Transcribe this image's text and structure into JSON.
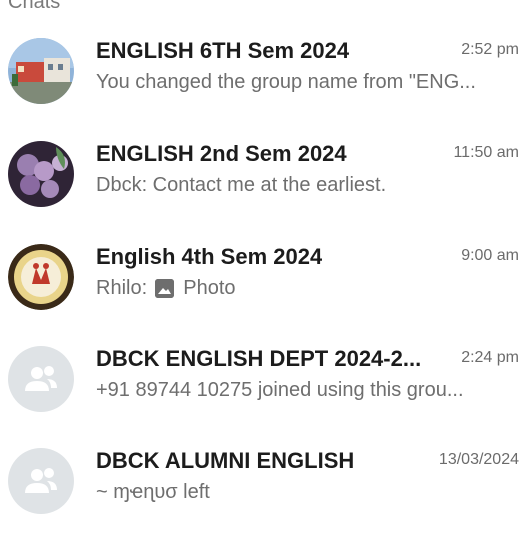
{
  "top_partial_label": "Chats",
  "chats": [
    {
      "name": "ENGLISH 6TH Sem 2024",
      "time": "2:52 pm",
      "preview": "You changed the group name from \"ENG...",
      "avatar": "building-photo"
    },
    {
      "name": "ENGLISH 2nd  Sem 2024",
      "time": "11:50 am",
      "preview": "Dbck: Contact me at the earliest.",
      "avatar": "berries-photo"
    },
    {
      "name": "English 4th Sem 2024",
      "time": "9:00 am",
      "preview_sender": "Rhilo:",
      "preview_icon": "photo-icon",
      "preview_text": "Photo",
      "avatar": "emblem-logo"
    },
    {
      "name": "DBCK ENGLISH DEPT 2024-2...",
      "time": "2:24 pm",
      "preview": "+91 89744 10275 joined using this grou...",
      "avatar": "default-group-icon"
    },
    {
      "name": "DBCK ALUMNI ENGLISH",
      "time": "13/03/2024",
      "preview": "~ ɱҽɳυσ left",
      "avatar": "default-group-icon"
    }
  ]
}
